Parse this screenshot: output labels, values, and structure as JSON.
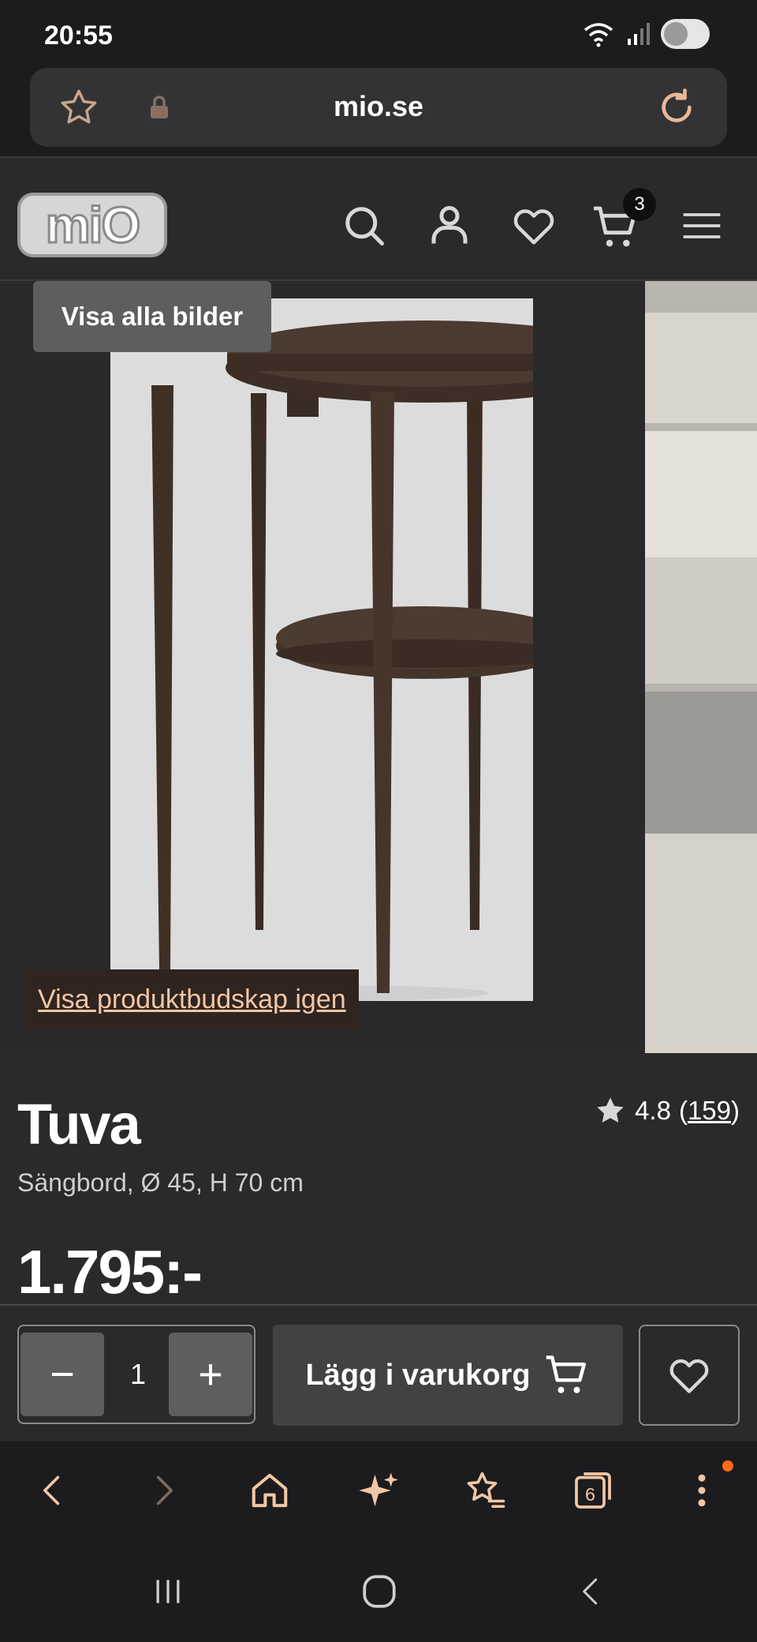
{
  "status_bar": {
    "time": "20:55"
  },
  "browser": {
    "url": "mio.se",
    "tab_count": "6"
  },
  "header": {
    "logo_text": "miO",
    "cart_count": "3"
  },
  "gallery": {
    "show_all_label": "Visa alla bilder",
    "promo_link": "Visa produktbudskap igen"
  },
  "product": {
    "name": "Tuva",
    "subtitle": "Sängbord, Ø 45, H 70 cm",
    "price": "1.795:-",
    "rating": "4.8",
    "rating_open": "(",
    "rating_count": "159",
    "rating_close": ")"
  },
  "cart_bar": {
    "minus": "−",
    "quantity": "1",
    "plus": "+",
    "add_to_cart": "Lägg i varukorg"
  },
  "colors": {
    "accent": "#f2c6a5",
    "background": "#2a2a2a",
    "notify": "#ff6a1a"
  }
}
